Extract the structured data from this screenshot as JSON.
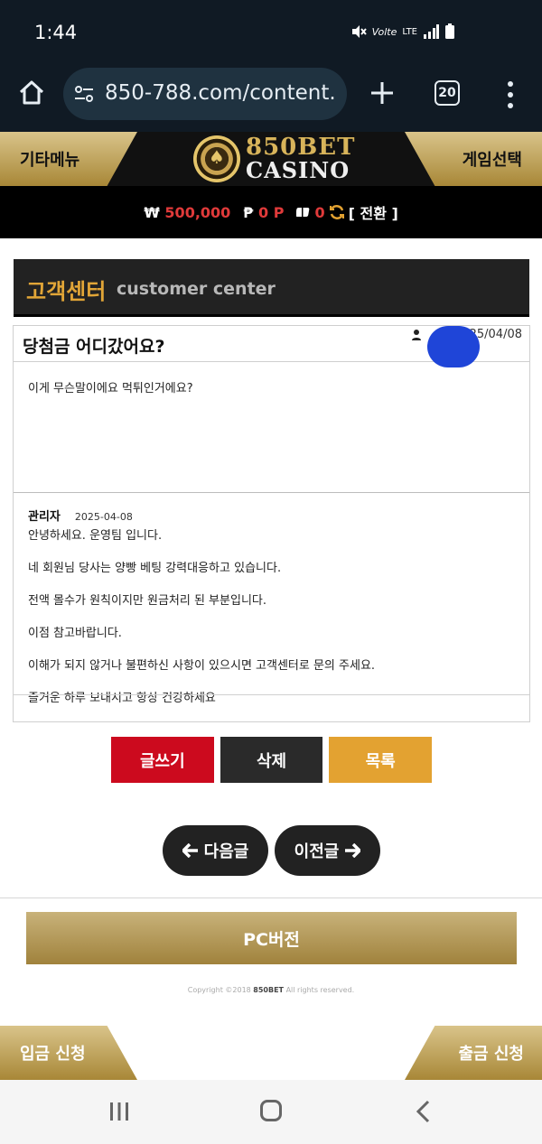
{
  "status_bar": {
    "time": "1:44",
    "volte": "Volte",
    "lte": "LTE"
  },
  "browser": {
    "url": "850-788.com/content.",
    "tab_count": "20"
  },
  "site_header": {
    "left_menu": "기타메뉴",
    "right_menu": "게임선택",
    "logo_line1": "850BET",
    "logo_line2": "CASINO"
  },
  "balance": {
    "won_symbol": "₩",
    "won_amount": "500,000",
    "point_symbol": "₱",
    "point_amount": "0 P",
    "chip_amount": "0",
    "convert_label": "[ 전환 ]"
  },
  "customer_center": {
    "title_ko": "고객센터",
    "title_en": "customer center"
  },
  "post": {
    "title": "당첨금 어디갔어요?",
    "date": "25/04/08",
    "body": "이게 무슨말이에요 먹튀인거에요?",
    "reply": {
      "author": "관리자",
      "date": "2025-04-08",
      "lines": [
        "안녕하세요. 운영팀 입니다.",
        "네 회원님 당사는 양빵 베팅 강력대응하고 있습니다.",
        "전액 몰수가 원칙이지만 원금처리 된 부분입니다.",
        "이점 참고바랍니다.",
        "이해가 되지 않거나 불편하신 사항이 있으시면 고객센터로 문의 주세요.",
        "즐거운 하루 보내시고 항상 건강하세요"
      ]
    }
  },
  "buttons": {
    "write": "글쓰기",
    "delete": "삭제",
    "list": "목록"
  },
  "navigation": {
    "next": "다음글",
    "prev": "이전글"
  },
  "pc_version": "PC버전",
  "copyright": {
    "prefix": "Copyright ©2018",
    "brand": "850BET",
    "suffix": "All rights reserved."
  },
  "footer": {
    "deposit": "입금 신청",
    "withdraw": "출금 신청"
  }
}
